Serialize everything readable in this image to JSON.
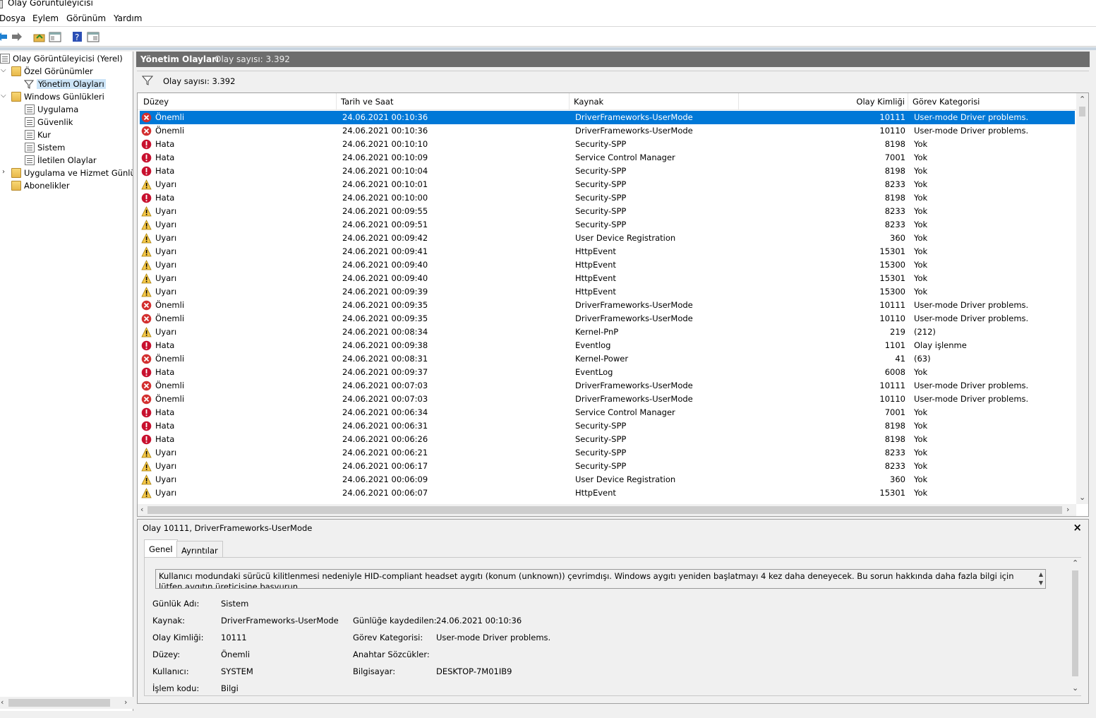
{
  "window": {
    "title": "Olay Görüntüleyicisi"
  },
  "menu": [
    "Dosya",
    "Eylem",
    "Görünüm",
    "Yardım"
  ],
  "toolbar": [
    "back-icon",
    "forward-icon",
    "up-folder-icon",
    "show-hide-tree-icon",
    "help-icon",
    "properties-icon"
  ],
  "tree": {
    "root": "Olay Görüntüleyicisi (Yerel)",
    "custom_views": "Özel Görünümler",
    "admin_events": "Yönetim Olayları",
    "windows_logs": "Windows Günlükleri",
    "application": "Uygulama",
    "security": "Güvenlik",
    "setup": "Kur",
    "system": "Sistem",
    "forwarded": "İletilen Olaylar",
    "app_service_logs": "Uygulama ve Hizmet Günlük",
    "subscriptions": "Abonelikler"
  },
  "main": {
    "title": "Yönetim Olayları",
    "count_label": "Olay sayısı: 3.392",
    "filter_count": "Olay sayısı: 3.392"
  },
  "columns": {
    "level": "Düzey",
    "date": "Tarih ve Saat",
    "source": "Kaynak",
    "event_id": "Olay Kimliği",
    "category": "Görev Kategorisi"
  },
  "rows": [
    {
      "level": "Önemli",
      "type": "critical",
      "date": "24.06.2021 00:10:36",
      "source": "DriverFrameworks-UserMode",
      "id": "10111",
      "cat": "User-mode Driver problems."
    },
    {
      "level": "Önemli",
      "type": "critical",
      "date": "24.06.2021 00:10:36",
      "source": "DriverFrameworks-UserMode",
      "id": "10110",
      "cat": "User-mode Driver problems."
    },
    {
      "level": "Hata",
      "type": "error",
      "date": "24.06.2021 00:10:10",
      "source": "Security-SPP",
      "id": "8198",
      "cat": "Yok"
    },
    {
      "level": "Hata",
      "type": "error",
      "date": "24.06.2021 00:10:09",
      "source": "Service Control Manager",
      "id": "7001",
      "cat": "Yok"
    },
    {
      "level": "Hata",
      "type": "error",
      "date": "24.06.2021 00:10:04",
      "source": "Security-SPP",
      "id": "8198",
      "cat": "Yok"
    },
    {
      "level": "Uyarı",
      "type": "warning",
      "date": "24.06.2021 00:10:01",
      "source": "Security-SPP",
      "id": "8233",
      "cat": "Yok"
    },
    {
      "level": "Hata",
      "type": "error",
      "date": "24.06.2021 00:10:00",
      "source": "Security-SPP",
      "id": "8198",
      "cat": "Yok"
    },
    {
      "level": "Uyarı",
      "type": "warning",
      "date": "24.06.2021 00:09:55",
      "source": "Security-SPP",
      "id": "8233",
      "cat": "Yok"
    },
    {
      "level": "Uyarı",
      "type": "warning",
      "date": "24.06.2021 00:09:51",
      "source": "Security-SPP",
      "id": "8233",
      "cat": "Yok"
    },
    {
      "level": "Uyarı",
      "type": "warning",
      "date": "24.06.2021 00:09:42",
      "source": "User Device Registration",
      "id": "360",
      "cat": "Yok"
    },
    {
      "level": "Uyarı",
      "type": "warning",
      "date": "24.06.2021 00:09:41",
      "source": "HttpEvent",
      "id": "15301",
      "cat": "Yok"
    },
    {
      "level": "Uyarı",
      "type": "warning",
      "date": "24.06.2021 00:09:40",
      "source": "HttpEvent",
      "id": "15300",
      "cat": "Yok"
    },
    {
      "level": "Uyarı",
      "type": "warning",
      "date": "24.06.2021 00:09:40",
      "source": "HttpEvent",
      "id": "15301",
      "cat": "Yok"
    },
    {
      "level": "Uyarı",
      "type": "warning",
      "date": "24.06.2021 00:09:39",
      "source": "HttpEvent",
      "id": "15300",
      "cat": "Yok"
    },
    {
      "level": "Önemli",
      "type": "critical",
      "date": "24.06.2021 00:09:35",
      "source": "DriverFrameworks-UserMode",
      "id": "10111",
      "cat": "User-mode Driver problems."
    },
    {
      "level": "Önemli",
      "type": "critical",
      "date": "24.06.2021 00:09:35",
      "source": "DriverFrameworks-UserMode",
      "id": "10110",
      "cat": "User-mode Driver problems."
    },
    {
      "level": "Uyarı",
      "type": "warning",
      "date": "24.06.2021 00:08:34",
      "source": "Kernel-PnP",
      "id": "219",
      "cat": "(212)"
    },
    {
      "level": "Hata",
      "type": "error",
      "date": "24.06.2021 00:09:38",
      "source": "Eventlog",
      "id": "1101",
      "cat": "Olay işlenme"
    },
    {
      "level": "Önemli",
      "type": "critical",
      "date": "24.06.2021 00:08:31",
      "source": "Kernel-Power",
      "id": "41",
      "cat": "(63)"
    },
    {
      "level": "Hata",
      "type": "error",
      "date": "24.06.2021 00:09:37",
      "source": "EventLog",
      "id": "6008",
      "cat": "Yok"
    },
    {
      "level": "Önemli",
      "type": "critical",
      "date": "24.06.2021 00:07:03",
      "source": "DriverFrameworks-UserMode",
      "id": "10111",
      "cat": "User-mode Driver problems."
    },
    {
      "level": "Önemli",
      "type": "critical",
      "date": "24.06.2021 00:07:03",
      "source": "DriverFrameworks-UserMode",
      "id": "10110",
      "cat": "User-mode Driver problems."
    },
    {
      "level": "Hata",
      "type": "error",
      "date": "24.06.2021 00:06:34",
      "source": "Service Control Manager",
      "id": "7001",
      "cat": "Yok"
    },
    {
      "level": "Hata",
      "type": "error",
      "date": "24.06.2021 00:06:31",
      "source": "Security-SPP",
      "id": "8198",
      "cat": "Yok"
    },
    {
      "level": "Hata",
      "type": "error",
      "date": "24.06.2021 00:06:26",
      "source": "Security-SPP",
      "id": "8198",
      "cat": "Yok"
    },
    {
      "level": "Uyarı",
      "type": "warning",
      "date": "24.06.2021 00:06:21",
      "source": "Security-SPP",
      "id": "8233",
      "cat": "Yok"
    },
    {
      "level": "Uyarı",
      "type": "warning",
      "date": "24.06.2021 00:06:17",
      "source": "Security-SPP",
      "id": "8233",
      "cat": "Yok"
    },
    {
      "level": "Uyarı",
      "type": "warning",
      "date": "24.06.2021 00:06:09",
      "source": "User Device Registration",
      "id": "360",
      "cat": "Yok"
    },
    {
      "level": "Uyarı",
      "type": "warning",
      "date": "24.06.2021 00:06:07",
      "source": "HttpEvent",
      "id": "15301",
      "cat": "Yok"
    }
  ],
  "detail": {
    "title": "Olay 10111, DriverFrameworks-UserMode",
    "close": "×",
    "tabs": [
      "Genel",
      "Ayrıntılar"
    ],
    "message": "Kullanıcı modundaki sürücü kilitlenmesi nedeniyle HID-compliant headset aygıtı (konum (unknown)) çevrimdışı.  Windows aygıtı yeniden başlatmayı 4 kez daha deneyecek.  Bu sorun hakkında daha fazla bilgi için lütfen aygıtın üreticisine başvurun.",
    "log_name_label": "Günlük Adı:",
    "log_name": "Sistem",
    "source_label": "Kaynak:",
    "source": "DriverFrameworks-UserMode",
    "logged_label": "Günlüğe kaydedilen:",
    "logged": "24.06.2021 00:10:36",
    "event_id_label": "Olay Kimliği:",
    "event_id": "10111",
    "task_label": "Görev Kategorisi:",
    "task": "User-mode Driver problems.",
    "level_label": "Düzey:",
    "level": "Önemli",
    "keywords_label": "Anahtar Sözcükler:",
    "keywords": "",
    "user_label": "Kullanıcı:",
    "user": "SYSTEM",
    "computer_label": "Bilgisayar:",
    "computer": "DESKTOP-7M01IB9",
    "opcode_label": "İşlem kodu:",
    "opcode": "Bilgi"
  },
  "colors": {
    "selection": "#0078d7",
    "header": "#6d6d6d",
    "critical": "#d32f2f",
    "error": "#c8102e",
    "warning": "#f7c948"
  }
}
